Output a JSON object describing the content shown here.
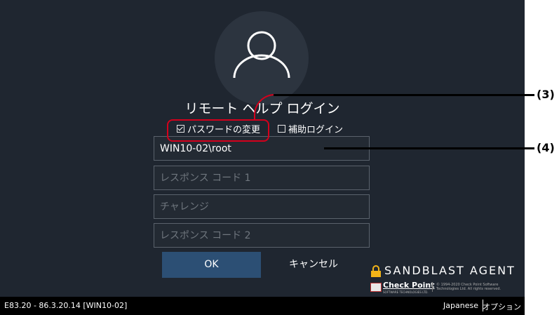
{
  "login": {
    "title": "リモート ヘルプ ログイン",
    "change_password_label": "パスワードの変更",
    "change_password_checked": true,
    "assist_login_label": "補助ログイン",
    "assist_login_checked": false,
    "username_value": "WIN10-02\\root",
    "response_code_1_placeholder": "レスポンス コード 1",
    "challenge_placeholder": "チャレンジ",
    "response_code_2_placeholder": "レスポンス コード 2",
    "ok_label": "OK",
    "cancel_label": "キャンセル"
  },
  "brand": {
    "product_name": "SANDBLAST AGENT",
    "vendor_name": "Check Point",
    "vendor_sub": "SOFTWARE TECHNOLOGIES LTD.",
    "copyright_line1": "© 1994-2020 Check Point Software",
    "copyright_line2": "Technologies Ltd. All rights reserved.",
    "lock_color": "#f2b418"
  },
  "status_bar": {
    "version": "E83.20 - 86.3.20.14 [WIN10-02]",
    "language": "Japanese",
    "options": "オプション"
  },
  "callouts": {
    "label_3": "(3)",
    "label_4": "(4)",
    "color": "#d4001c"
  },
  "colors": {
    "background": "#1f2630",
    "ok_button": "#2c4f74",
    "status_bar": "#000000"
  }
}
